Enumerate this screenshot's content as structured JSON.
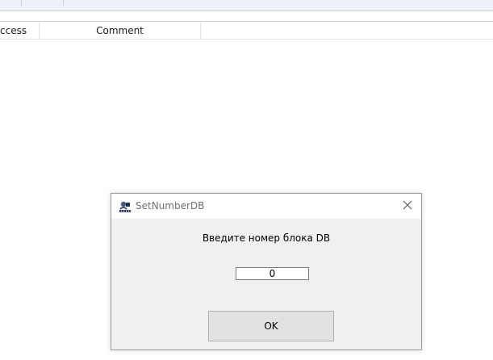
{
  "background_table": {
    "columns": [
      {
        "label": "ccess"
      },
      {
        "label": "Comment"
      }
    ]
  },
  "dialog": {
    "title": "SetNumberDB",
    "prompt": "Введите номер блока DB",
    "input_value": "0",
    "ok_label": "OK",
    "close_icon": "close-icon",
    "app_icon": "app-icon"
  }
}
